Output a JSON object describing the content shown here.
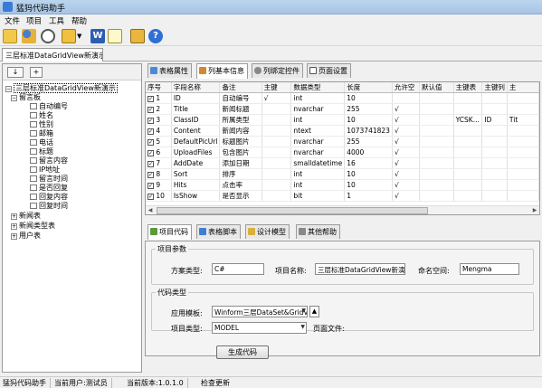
{
  "app": {
    "title": "猛犸代码助手"
  },
  "menu": [
    "文件",
    "项目",
    "工具",
    "帮助"
  ],
  "toolbar_icons": [
    "open-folder-icon",
    "users-icon",
    "search-icon",
    "add-icon",
    "dropdown-icon",
    "word-icon",
    "document-icon",
    "export-icon",
    "help-icon"
  ],
  "doc_tab": {
    "label": "三层标准DataGridView新演示"
  },
  "tree": {
    "buttons": [
      "↓",
      "+"
    ],
    "root": "三层标准DataGridView新演示",
    "table1": "留言板",
    "fields": [
      "自动编号",
      "姓名",
      "性别",
      "邮箱",
      "电话",
      "标题",
      "留言内容",
      "IP地址",
      "留言时间",
      "是否回复",
      "回复内容",
      "回复时间"
    ],
    "others": [
      "新闻表",
      "新闻类型表",
      "用户表"
    ]
  },
  "top_tabs": [
    "表格属性",
    "列基本信息",
    "列绑定控件",
    "页面设置"
  ],
  "grid": {
    "headers": [
      "序号",
      "字段名称",
      "备注",
      "主键",
      "数据类型",
      "长度",
      "允许空",
      "默认值",
      "主键表",
      "主键列",
      "主"
    ],
    "rows": [
      {
        "n": "1",
        "name": "ID",
        "note": "自动编号",
        "pk": "√",
        "type": "int",
        "len": "10",
        "nul": "",
        "def": "",
        "pkt": "",
        "pkc": "",
        "m": ""
      },
      {
        "n": "2",
        "name": "Title",
        "note": "新闻标题",
        "pk": "",
        "type": "nvarchar",
        "len": "255",
        "nul": "√",
        "def": "",
        "pkt": "",
        "pkc": "",
        "m": ""
      },
      {
        "n": "3",
        "name": "ClassID",
        "note": "所属类型",
        "pk": "",
        "type": "int",
        "len": "10",
        "nul": "√",
        "def": "",
        "pkt": "YCSK...",
        "pkc": "ID",
        "m": "Tit"
      },
      {
        "n": "4",
        "name": "Content",
        "note": "新闻内容",
        "pk": "",
        "type": "ntext",
        "len": "1073741823",
        "nul": "√",
        "def": "",
        "pkt": "",
        "pkc": "",
        "m": ""
      },
      {
        "n": "5",
        "name": "DefaultPicUrl",
        "note": "标题图片",
        "pk": "",
        "type": "nvarchar",
        "len": "255",
        "nul": "√",
        "def": "",
        "pkt": "",
        "pkc": "",
        "m": ""
      },
      {
        "n": "6",
        "name": "UploadFiles",
        "note": "包含图片",
        "pk": "",
        "type": "nvarchar",
        "len": "4000",
        "nul": "√",
        "def": "",
        "pkt": "",
        "pkc": "",
        "m": ""
      },
      {
        "n": "7",
        "name": "AddDate",
        "note": "添加日期",
        "pk": "",
        "type": "smalldatetime",
        "len": "16",
        "nul": "√",
        "def": "",
        "pkt": "",
        "pkc": "",
        "m": ""
      },
      {
        "n": "8",
        "name": "Sort",
        "note": "排序",
        "pk": "",
        "type": "int",
        "len": "10",
        "nul": "√",
        "def": "",
        "pkt": "",
        "pkc": "",
        "m": ""
      },
      {
        "n": "9",
        "name": "Hits",
        "note": "点击率",
        "pk": "",
        "type": "int",
        "len": "10",
        "nul": "√",
        "def": "",
        "pkt": "",
        "pkc": "",
        "m": ""
      },
      {
        "n": "10",
        "name": "IsShow",
        "note": "是否显示",
        "pk": "",
        "type": "bit",
        "len": "1",
        "nul": "√",
        "def": "",
        "pkt": "",
        "pkc": "",
        "m": ""
      }
    ]
  },
  "bottom_tabs": [
    "项目代码",
    "表格脚本",
    "设计模型",
    "其他帮助"
  ],
  "project_params": {
    "legend": "项目参数",
    "scheme_label": "方案类型:",
    "scheme_value": "C#",
    "name_label": "项目名称:",
    "name_value": "三层标准DataGridView新演示",
    "ns_label": "命名空间:",
    "ns_value": "Mengma"
  },
  "code_type": {
    "legend": "代码类型",
    "template_label": "应用模板:",
    "template_value": "Winform三层DataSet&GridView",
    "type_label": "项目类型:",
    "type_value": "MODEL",
    "page_label": "页面文件:"
  },
  "generate_button": "生成代码",
  "status": [
    "猛犸代码助手",
    "当前用户:测试员",
    "当前版本:1.0.1.0",
    "检查更新"
  ]
}
